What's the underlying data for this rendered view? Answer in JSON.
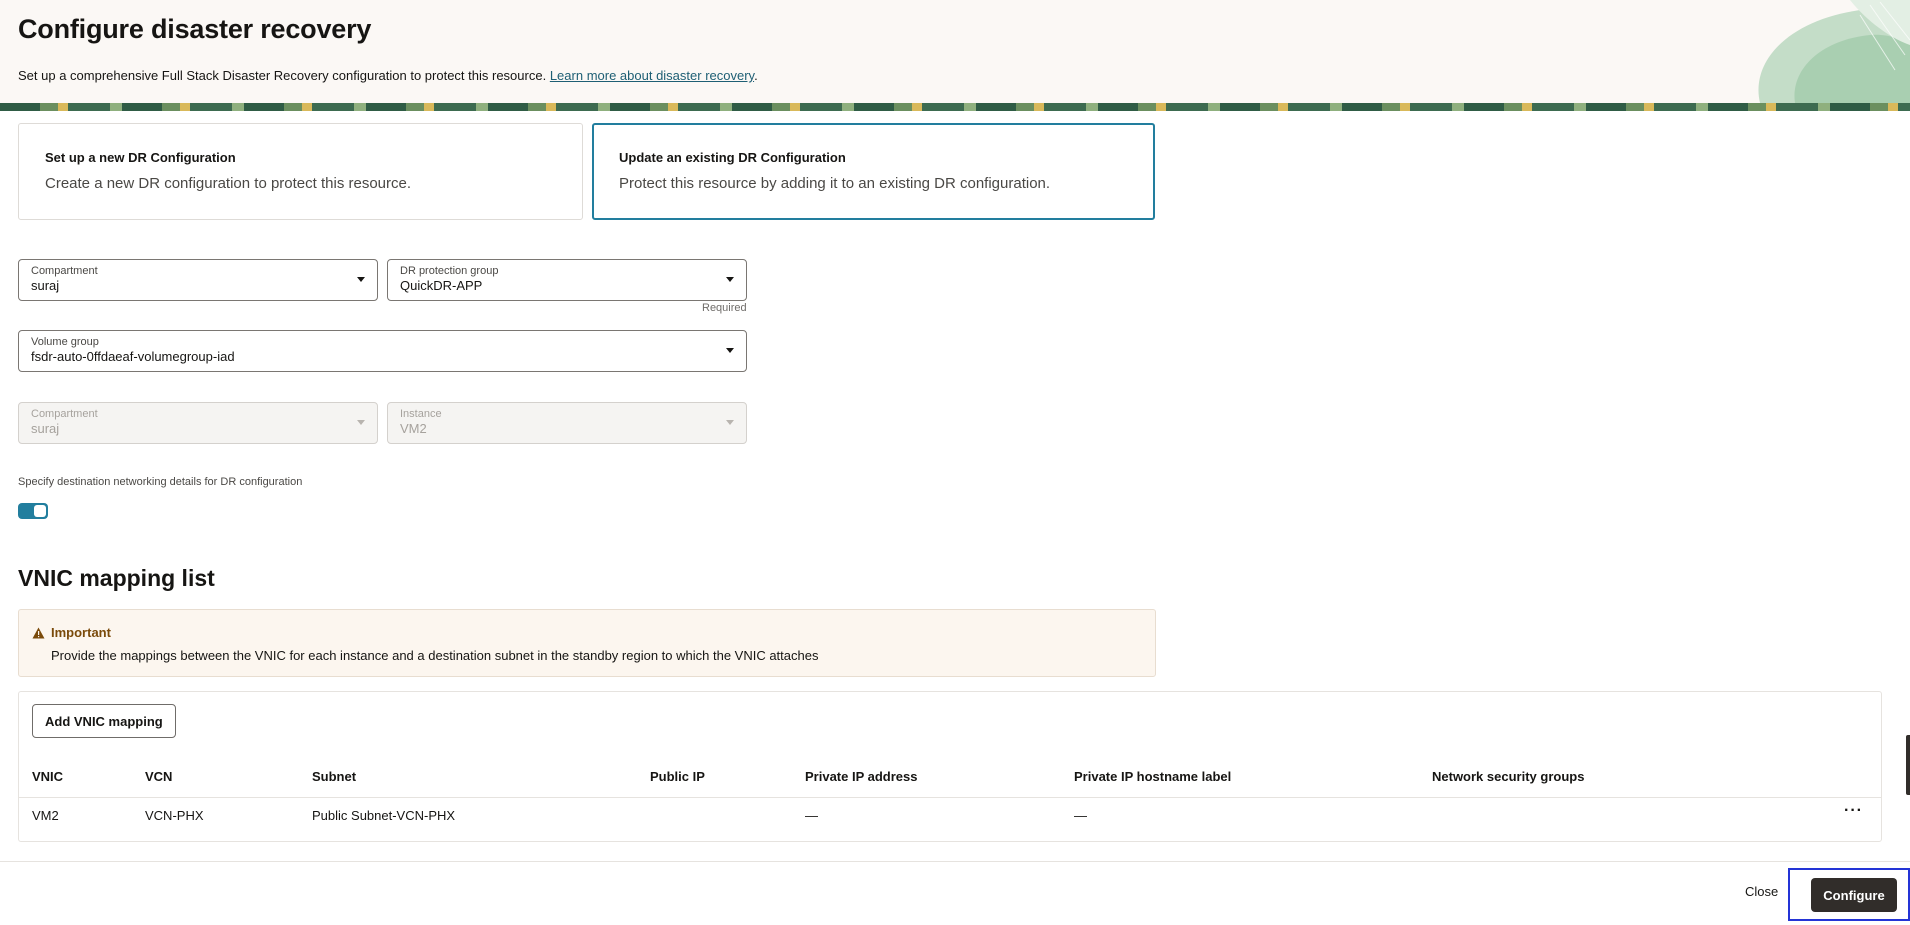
{
  "header": {
    "title": "Configure disaster recovery",
    "description": "Set up a comprehensive Full Stack Disaster Recovery configuration to protect this resource.",
    "learn_more_link": "Learn more about disaster recovery",
    "period": "."
  },
  "options": [
    {
      "title": "Set up a new DR Configuration",
      "description": "Create a new DR configuration to protect this resource.",
      "selected": false
    },
    {
      "title": "Update an existing DR Configuration",
      "description": "Protect this resource by adding it to an existing DR configuration.",
      "selected": true
    }
  ],
  "fields": {
    "compartment": {
      "label": "Compartment",
      "value": "suraj"
    },
    "dr_protection_group": {
      "label": "DR protection group",
      "value": "QuickDR-APP",
      "hint": "Required"
    },
    "volume_group": {
      "label": "Volume group",
      "value": "fsdr-auto-0ffdaeaf-volumegroup-iad"
    },
    "source_compartment": {
      "label": "Compartment",
      "value": "suraj",
      "disabled": true
    },
    "instance": {
      "label": "Instance",
      "value": "VM2",
      "disabled": true
    }
  },
  "networking_toggle": {
    "label": "Specify destination networking details for DR configuration",
    "on": true
  },
  "vnic_section": {
    "title": "VNIC mapping list",
    "notice": {
      "title": "Important",
      "text": "Provide the mappings between the VNIC for each instance and a destination subnet in the standby region to which the VNIC attaches"
    },
    "add_button": "Add VNIC mapping",
    "columns": [
      "VNIC",
      "VCN",
      "Subnet",
      "Public IP",
      "Private IP address",
      "Private IP hostname label",
      "Network security groups"
    ],
    "rows": [
      {
        "vnic": "VM2",
        "vcn": "VCN-PHX",
        "subnet": "Public Subnet-VCN-PHX",
        "public_ip": "",
        "private_ip": "—",
        "hostname_label": "—",
        "nsg": "",
        "actions": "···"
      }
    ]
  },
  "footer": {
    "close_label": "Close",
    "configure_label": "Configure"
  },
  "colors": {
    "accent": "#227e9e",
    "primary_button": "#312d2a",
    "warning": "#7a4a0a",
    "focus": "#2434d6"
  }
}
